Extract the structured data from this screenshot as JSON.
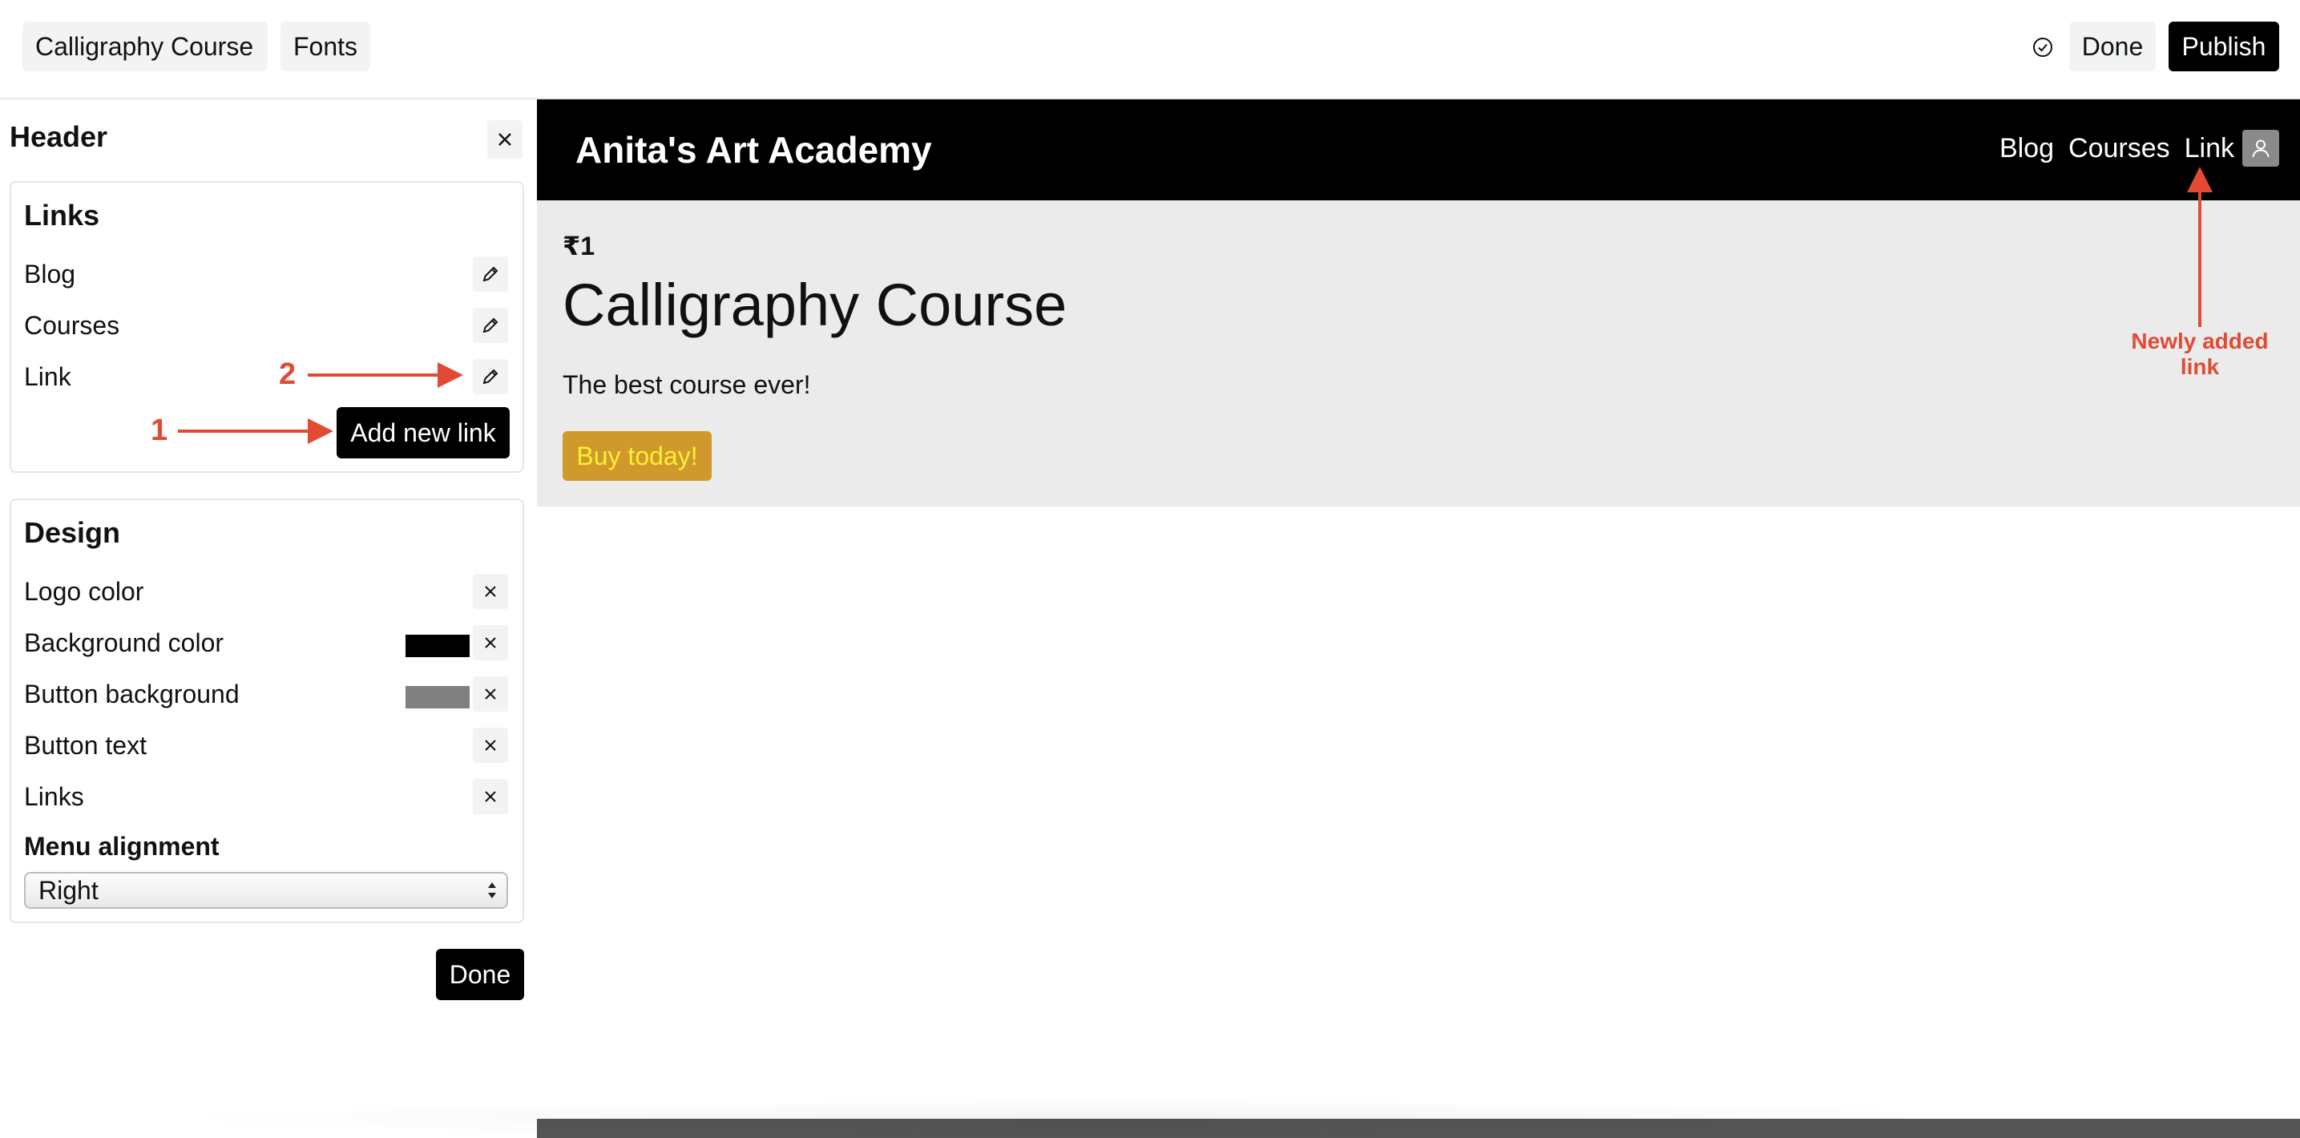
{
  "topbar": {
    "tabs": [
      "Calligraphy Course",
      "Fonts"
    ],
    "done_label": "Done",
    "publish_label": "Publish"
  },
  "panel": {
    "title": "Header",
    "links_card": {
      "title": "Links",
      "items": [
        "Blog",
        "Courses",
        "Link"
      ],
      "add_label": "Add new link"
    },
    "design_card": {
      "title": "Design",
      "rows": [
        "Logo color",
        "Background color",
        "Button background",
        "Button text",
        "Links"
      ],
      "background_color": "#000000",
      "button_background": "#808080",
      "menu_alignment_label": "Menu alignment",
      "menu_alignment_value": "Right"
    },
    "done_label": "Done"
  },
  "preview": {
    "logo": "Anita's Art Academy",
    "nav": [
      "Blog",
      "Courses",
      "Link"
    ],
    "price": "₹1",
    "title": "Calligraphy Course",
    "description": "The best course ever!",
    "buy_label": "Buy today!"
  },
  "annotations": {
    "number_1": "1",
    "number_2": "2",
    "new_link_note": "Newly added link",
    "color": "#e24a33"
  }
}
